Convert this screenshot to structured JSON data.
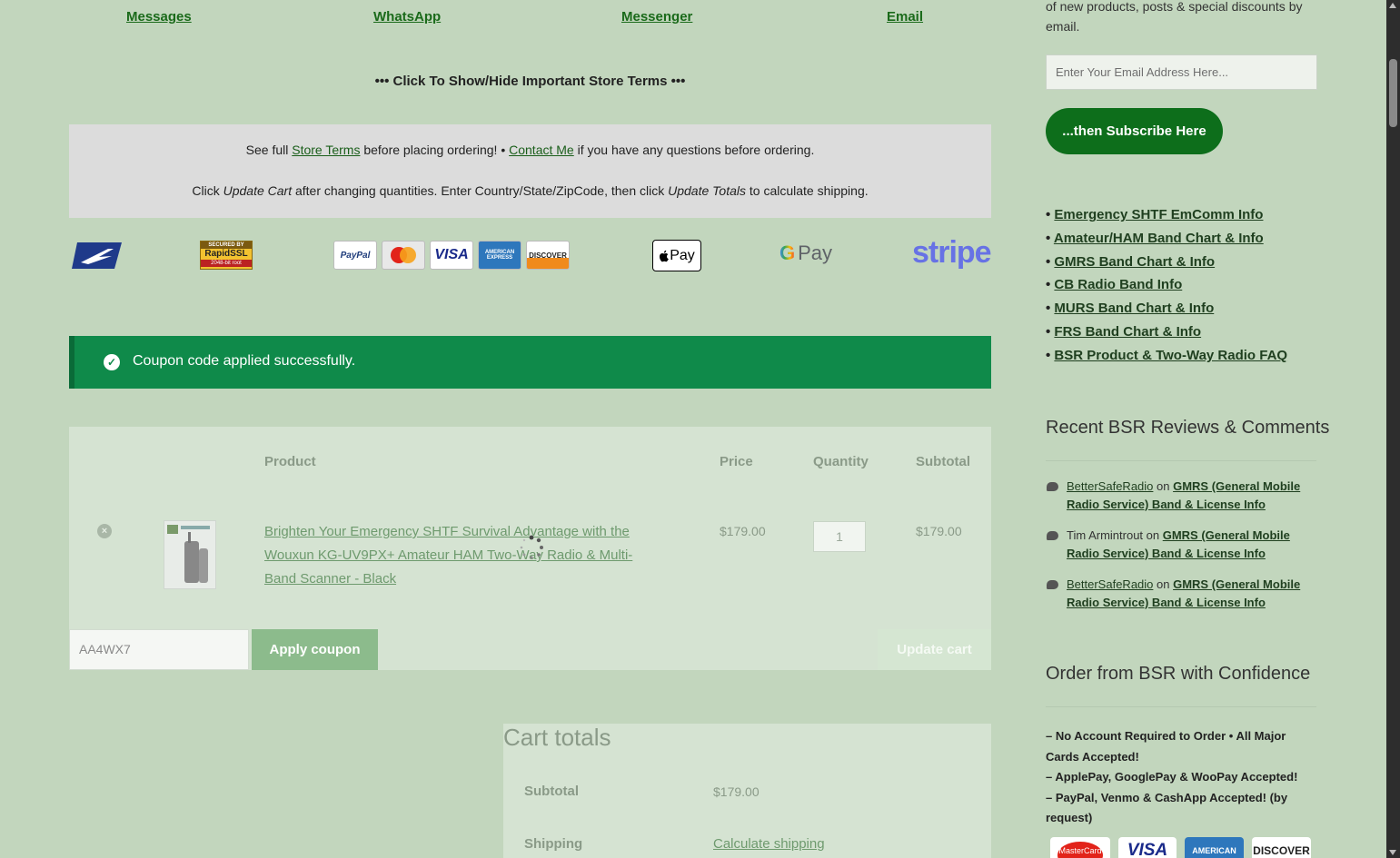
{
  "contact": {
    "messages": "Messages",
    "whatsapp": "WhatsApp",
    "messenger": "Messenger",
    "email": "Email"
  },
  "terms_toggle": "••• Click To Show/Hide Important Store Terms •••",
  "terms": {
    "line1_pre": "See full ",
    "store_terms": "Store Terms",
    "line1_mid": " before placing ordering! • ",
    "contact_me": "Contact Me",
    "line1_post": " if you have any questions before ordering.",
    "line2_a": "Click ",
    "update_cart_em": "Update Cart",
    "line2_b": " after changing quantities. Enter Country/State/ZipCode, then click ",
    "update_totals_em": "Update Totals",
    "line2_c": " to calculate shipping."
  },
  "logos": {
    "rapidssl_top": "SECURED BY",
    "rapidssl_mid": "RapidSSL",
    "rapidssl_bot": "2048-bit root",
    "paypal": "PayPal",
    "mastercard": "MasterCard",
    "visa": "VISA",
    "amex": "AMERICAN EXPRESS",
    "discover": "DISCOVER",
    "applepay": "Pay",
    "gpay": "Pay",
    "stripe": "stripe"
  },
  "notice": {
    "message": "Coupon code applied successfully."
  },
  "cart": {
    "headers": {
      "product": "Product",
      "price": "Price",
      "quantity": "Quantity",
      "subtotal": "Subtotal"
    },
    "item": {
      "remove": "×",
      "name": "Brighten Your Emergency SHTF Survival Advantage with the Wouxun KG-UV9PX+ Amateur HAM Two-Way Radio & Multi-Band Scanner - Black",
      "price": "$179.00",
      "quantity": "1",
      "subtotal": "$179.00"
    },
    "coupon_value": "AA4WX7",
    "apply_label": "Apply coupon",
    "update_label": "Update cart"
  },
  "totals": {
    "title": "Cart totals",
    "subtotal_label": "Subtotal",
    "subtotal_value": "$179.00",
    "shipping_label": "Shipping",
    "shipping_link": "Calculate shipping"
  },
  "sidebar": {
    "newsletter_text": "of new products, posts & special discounts by email.",
    "email_placeholder": "Enter Your Email Address Here...",
    "subscribe_label": "...then Subscribe Here",
    "info_links": [
      "Emergency SHTF EmComm Info",
      "Amateur/HAM Band Chart & Info",
      "GMRS Band Chart & Info",
      "CB Radio Band Info",
      "MURS Band Chart & Info",
      "FRS Band Chart & Info",
      "BSR Product & Two-Way Radio FAQ"
    ],
    "reviews_heading": "Recent BSR Reviews & Comments",
    "reviews": [
      {
        "author": "BetterSafeRadio",
        "on": " on ",
        "post": "GMRS (General Mobile Radio Service) Band & License Info"
      },
      {
        "author": "Tim Armintrout",
        "on": " on ",
        "post": "GMRS (General Mobile Radio Service) Band & License Info"
      },
      {
        "author": "BetterSafeRadio",
        "on": " on ",
        "post": "GMRS (General Mobile Radio Service) Band & License Info"
      }
    ],
    "confidence_heading": "Order from BSR with Confidence",
    "confidence_lines": [
      "– No Account Required to Order • All Major Cards Accepted!",
      "– ApplePay, GooglePay & WooPay Accepted!",
      "– PayPal, Venmo & CashApp Accepted! (by request)"
    ],
    "card_labels": [
      "MasterCard",
      "VISA",
      "AMERICAN",
      "DISCOVER"
    ]
  }
}
